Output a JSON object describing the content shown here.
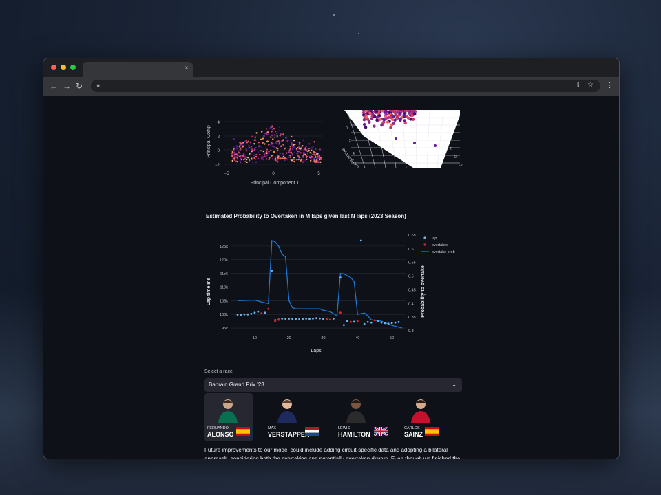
{
  "window_controls": {
    "close_color": "#ff5f57",
    "min_color": "#febc2e",
    "max_color": "#28c840"
  },
  "tab": {
    "close_label": "×"
  },
  "toolbar": {
    "back_label": "←",
    "forward_label": "→",
    "reload_label": "↻",
    "lock_icon": "🔒",
    "share_icon": "⇪",
    "bookmark_icon": "☆",
    "menu_icon": "⋮"
  },
  "pca2d": {
    "xlabel": "Principal Component 1",
    "ylabel": "Principal Comp",
    "xticks": [
      "−5",
      "0",
      "5"
    ],
    "yticks": [
      "4",
      "2",
      "0",
      "−2"
    ]
  },
  "pca3d": {
    "axis_label": "Principal Co",
    "tick_labels": [
      "0",
      "2",
      "4",
      "6",
      "2",
      "0",
      "−2"
    ]
  },
  "chart_data": {
    "type": "scatter",
    "title": "Estimated Probability to Overtaken in M laps given last N laps (2023 Season)",
    "xlabel": "Laps",
    "ylabel": "Lap time ms",
    "y2label": "Probability to overtake",
    "xticks": [
      "10",
      "20",
      "30",
      "40",
      "50"
    ],
    "yticks": [
      "95k",
      "100k",
      "105k",
      "110k",
      "115k",
      "120k",
      "125k"
    ],
    "y2ticks": [
      "0.3",
      "0.35",
      "0.4",
      "0.45",
      "0.5",
      "0.55",
      "0.6",
      "0.65"
    ],
    "xlim": [
      3,
      54
    ],
    "ylim": [
      94000,
      129000
    ],
    "y2lim": [
      0.3,
      0.65
    ],
    "legend": [
      "lap",
      "overtakes",
      "overtake prob"
    ],
    "legend_position": "right",
    "colors": {
      "lap": "#6ab7f0",
      "overtakes": "#d62728",
      "prob": "#1f77d4"
    },
    "laps": [
      [
        5,
        99.9
      ],
      [
        6,
        99.9
      ],
      [
        7,
        100
      ],
      [
        8,
        100
      ],
      [
        9,
        100.2
      ],
      [
        10,
        100.6
      ],
      [
        11,
        101
      ],
      [
        13,
        100.6
      ],
      [
        15,
        116
      ],
      [
        16,
        97.9
      ],
      [
        17,
        98.1
      ],
      [
        18,
        98.4
      ],
      [
        19,
        98.3
      ],
      [
        20,
        98.4
      ],
      [
        21,
        98.3
      ],
      [
        22,
        98.3
      ],
      [
        23,
        98.2
      ],
      [
        24,
        98.3
      ],
      [
        25,
        98.4
      ],
      [
        26,
        98.3
      ],
      [
        27,
        98.4
      ],
      [
        28,
        98.6
      ],
      [
        29,
        98.5
      ],
      [
        30,
        98.3
      ],
      [
        33,
        98.4
      ],
      [
        35,
        113.5
      ],
      [
        36,
        96.1
      ],
      [
        37,
        97.5
      ],
      [
        39,
        97.3
      ],
      [
        41,
        127
      ],
      [
        42,
        96.5
      ],
      [
        43,
        97.2
      ],
      [
        44,
        97.0
      ],
      [
        46,
        97.4
      ],
      [
        47,
        97.0
      ],
      [
        48,
        96.8
      ],
      [
        49,
        96.6
      ],
      [
        50,
        96.8
      ],
      [
        51,
        97.0
      ],
      [
        52,
        97.2
      ]
    ],
    "overtakes": [
      [
        12,
        100.4
      ],
      [
        14,
        102
      ],
      [
        16,
        97.5
      ],
      [
        17,
        98
      ],
      [
        31,
        98.2
      ],
      [
        32,
        98.1
      ],
      [
        35,
        100.6
      ],
      [
        38,
        97.2
      ],
      [
        40,
        97.5
      ],
      [
        45,
        97.8
      ]
    ],
    "prob": [
      [
        5,
        0.41
      ],
      [
        10,
        0.412
      ],
      [
        12,
        0.405
      ],
      [
        14,
        0.4
      ],
      [
        15,
        0.63
      ],
      [
        16,
        0.625
      ],
      [
        17,
        0.61
      ],
      [
        18,
        0.58
      ],
      [
        19,
        0.57
      ],
      [
        20,
        0.41
      ],
      [
        21,
        0.385
      ],
      [
        22,
        0.38
      ],
      [
        26,
        0.38
      ],
      [
        29,
        0.38
      ],
      [
        30,
        0.375
      ],
      [
        32,
        0.37
      ],
      [
        34,
        0.355
      ],
      [
        35,
        0.51
      ],
      [
        36,
        0.508
      ],
      [
        38,
        0.495
      ],
      [
        39,
        0.48
      ],
      [
        40,
        0.36
      ],
      [
        42,
        0.365
      ],
      [
        43,
        0.355
      ],
      [
        44,
        0.34
      ],
      [
        47,
        0.335
      ],
      [
        50,
        0.32
      ],
      [
        53,
        0.31
      ]
    ]
  },
  "race_select": {
    "label": "Select a race",
    "value": "Bahrain Grand Prix '23"
  },
  "drivers": [
    {
      "first": "FERNANDO",
      "last": "ALONSO",
      "flag": "spain",
      "suit": "#0a6e4f",
      "selected": true
    },
    {
      "first": "MAX",
      "last": "VERSTAPPEN",
      "flag": "netherlands",
      "suit": "#1e2a5e",
      "selected": false
    },
    {
      "first": "LEWIS",
      "last": "HAMILTON",
      "flag": "uk",
      "suit": "#2b2b2b",
      "selected": false
    },
    {
      "first": "CARLOS",
      "last": "SAINZ",
      "flag": "spain",
      "suit": "#c8102e",
      "selected": false
    }
  ],
  "paragraph": "Future improvements to our model could include adding circuit-specific data and adopting a bilateral approach, considering both the overtaking and potentially overtaken drivers. Even though we finished the"
}
